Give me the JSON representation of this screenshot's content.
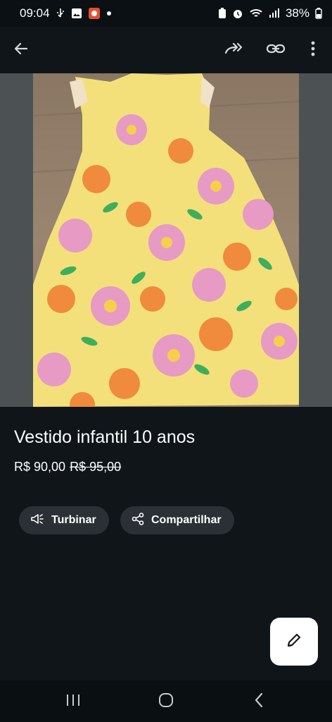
{
  "status_bar": {
    "time": "09:04",
    "battery": "38%"
  },
  "product": {
    "title": "Vestido infantil 10 anos",
    "price": "R$ 90,00",
    "old_price": "R$ 95,00"
  },
  "actions": {
    "boost_label": "Turbinar",
    "share_label": "Compartilhar"
  },
  "colors": {
    "background": "#0f1519",
    "chip": "#2a3035",
    "dress_yellow": "#f3e07a",
    "flower_pink": "#e79ac4",
    "flower_orange": "#f08a3c"
  },
  "icons": {
    "back": "arrow-left-icon",
    "share": "forward-share-icon",
    "link": "link-icon",
    "more": "more-vert-icon",
    "edit": "pencil-icon"
  }
}
